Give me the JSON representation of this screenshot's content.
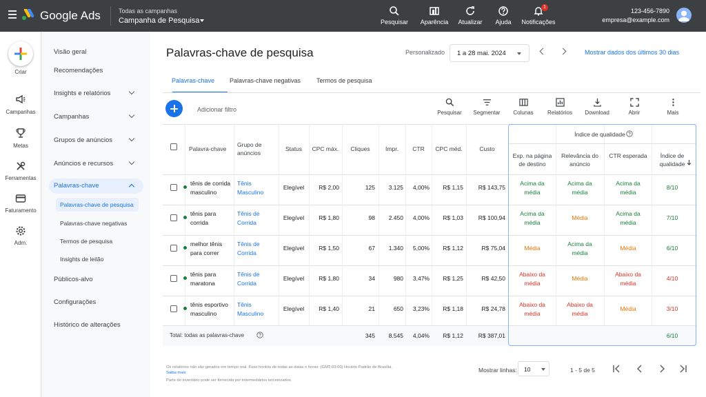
{
  "topbar": {
    "brand": "Google Ads",
    "all_campaigns": "Todas as campanhas",
    "campaign": "Campanha de Pesquisa",
    "actions": [
      {
        "label": "Pesquisar",
        "icon": "search-icon"
      },
      {
        "label": "Aparência",
        "icon": "appearance-icon"
      },
      {
        "label": "Atualizar",
        "icon": "refresh-icon"
      },
      {
        "label": "Ajuda",
        "icon": "help-icon"
      },
      {
        "label": "Notificações",
        "icon": "bell-icon"
      }
    ],
    "notification_count": "1",
    "account_id": "123-456-7890",
    "account_email": "empresa@example.com",
    "colors": {
      "bar": "#3c4043",
      "accent": "#1a73e8"
    }
  },
  "rail": {
    "items": [
      {
        "label": "Criar",
        "icon": "plus-icon"
      },
      {
        "label": "Campanhas",
        "icon": "megaphone-icon"
      },
      {
        "label": "Metas",
        "icon": "trophy-icon"
      },
      {
        "label": "Ferramentas",
        "icon": "tools-icon"
      },
      {
        "label": "Faturamento",
        "icon": "credit-card-icon"
      },
      {
        "label": "Adm.",
        "icon": "gear-icon"
      }
    ]
  },
  "nav": {
    "items": [
      "Visão geral",
      "Recomendações",
      "Insights e relatórios",
      "Campanhas",
      "Grupos de anúncios",
      "Anúncios e recursos",
      "Palavras-chave",
      "Públicos-alvo",
      "Configurações",
      "Histórico de alterações"
    ],
    "subitems": [
      "Palavras-chave de pesquisa",
      "Palavras-chave negativas",
      "Termos de pesquisa",
      "Insights de leilão"
    ]
  },
  "page": {
    "title": "Palavras-chave de pesquisa",
    "date_label": "Personalizado",
    "date_range": "1 a 28 mai. 2024",
    "show_last": "Mostrar dados dos últimos 30 dias"
  },
  "tabs": [
    "Palavras-chave",
    "Palavras-chave negativas",
    "Termos de pesquisa"
  ],
  "toolbar": {
    "add_filter": "Adicionar filtro",
    "tools": [
      {
        "label": "Pesquisar",
        "icon": "search-icon"
      },
      {
        "label": "Segmentar",
        "icon": "segment-icon"
      },
      {
        "label": "Colunas",
        "icon": "columns-icon"
      },
      {
        "label": "Relatórios",
        "icon": "reports-icon"
      },
      {
        "label": "Download",
        "icon": "download-icon"
      },
      {
        "label": "Abrir",
        "icon": "expand-icon"
      },
      {
        "label": "Mais",
        "icon": "more-vert-icon"
      }
    ]
  },
  "table": {
    "quality_group": "Índice de qualidade",
    "headers": [
      "Palavra-chave",
      "Grupo de anúncios",
      "Status",
      "CPC máx.",
      "Cliques",
      "Impr.",
      "CTR",
      "CPC méd.",
      "Custo",
      "Exp. na página de destino",
      "Relevância do anúncio",
      "CTR esperada",
      "Índice de qualidade"
    ],
    "rows": [
      {
        "keyword": "tênis de corrida masculino",
        "group": "Tênis Masculino",
        "status": "Elegível",
        "cpc_max": "R$ 2,00",
        "clicks": "125",
        "impr": "3.125",
        "ctr": "4,00%",
        "cpc_avg": "R$ 1,15",
        "cost": "R$ 143,75",
        "landing": "Acima da média",
        "relevance": "Acima da média",
        "exp_ctr": "Acima da média",
        "score": "8/10",
        "c1": "above",
        "c2": "above",
        "c3": "above"
      },
      {
        "keyword": "tênis para corrida",
        "group": "Tênis de Corrida",
        "status": "Elegível",
        "cpc_max": "R$ 1,80",
        "clicks": "98",
        "impr": "2.450",
        "ctr": "4,00%",
        "cpc_avg": "R$ 1,03",
        "cost": "R$ 100,94",
        "landing": "Acima da média",
        "relevance": "Média",
        "exp_ctr": "Acima da média",
        "score": "7/10",
        "c1": "above",
        "c2": "mid",
        "c3": "above"
      },
      {
        "keyword": "melhor tênis para correr",
        "group": "Tênis de Corrida",
        "status": "Elegível",
        "cpc_max": "R$ 1,50",
        "clicks": "67",
        "impr": "1.340",
        "ctr": "5,00%",
        "cpc_avg": "R$ 1,12",
        "cost": "R$ 75,04",
        "landing": "Média",
        "relevance": "Acima da média",
        "exp_ctr": "Média",
        "score": "6/10",
        "c1": "mid",
        "c2": "above",
        "c3": "mid"
      },
      {
        "keyword": "tênis para maratona",
        "group": "Tênis de Corrida",
        "status": "Elegível",
        "cpc_max": "R$ 1,80",
        "clicks": "34",
        "impr": "980",
        "ctr": "3,47%",
        "cpc_avg": "R$ 1,25",
        "cost": "R$ 42,50",
        "landing": "Abaixo da média",
        "relevance": "Média",
        "exp_ctr": "Abaixo da média",
        "score": "4/10",
        "c1": "below",
        "c2": "mid",
        "c3": "below"
      },
      {
        "keyword": "tênis esportivo masculino",
        "group": "Tênis Masculino",
        "status": "Elegível",
        "cpc_max": "R$ 1,40",
        "clicks": "21",
        "impr": "650",
        "ctr": "3,23%",
        "cpc_avg": "R$ 1,18",
        "cost": "R$ 24,78",
        "landing": "Abaixo da média",
        "relevance": "Abaixo da média",
        "exp_ctr": "Média",
        "score": "3/10",
        "c1": "below",
        "c2": "below",
        "c3": "mid"
      }
    ],
    "total": {
      "label": "Total: todas as palavras-chave",
      "clicks": "345",
      "impr": "8.545",
      "ctr": "4,04%",
      "cpc_avg": "R$ 1,12",
      "cost": "R$ 387,01",
      "score": "6/10"
    },
    "colors": {
      "above": "#188038",
      "mid": "#e37400",
      "below": "#d93025"
    }
  },
  "footer": {
    "note1": "Os relatórios não são gerados em tempo real. Fuso horário de todas as datas e horas: (GMT-03:00) Horário Padrão de Brasília.",
    "note1_link": "Saiba mais",
    "note2": "Parte do inventário pode ser fornecida por intermediários terceirizados.",
    "rows_label": "Mostrar linhas:",
    "rows_value": "10",
    "range": "1 - 5 de 5"
  }
}
